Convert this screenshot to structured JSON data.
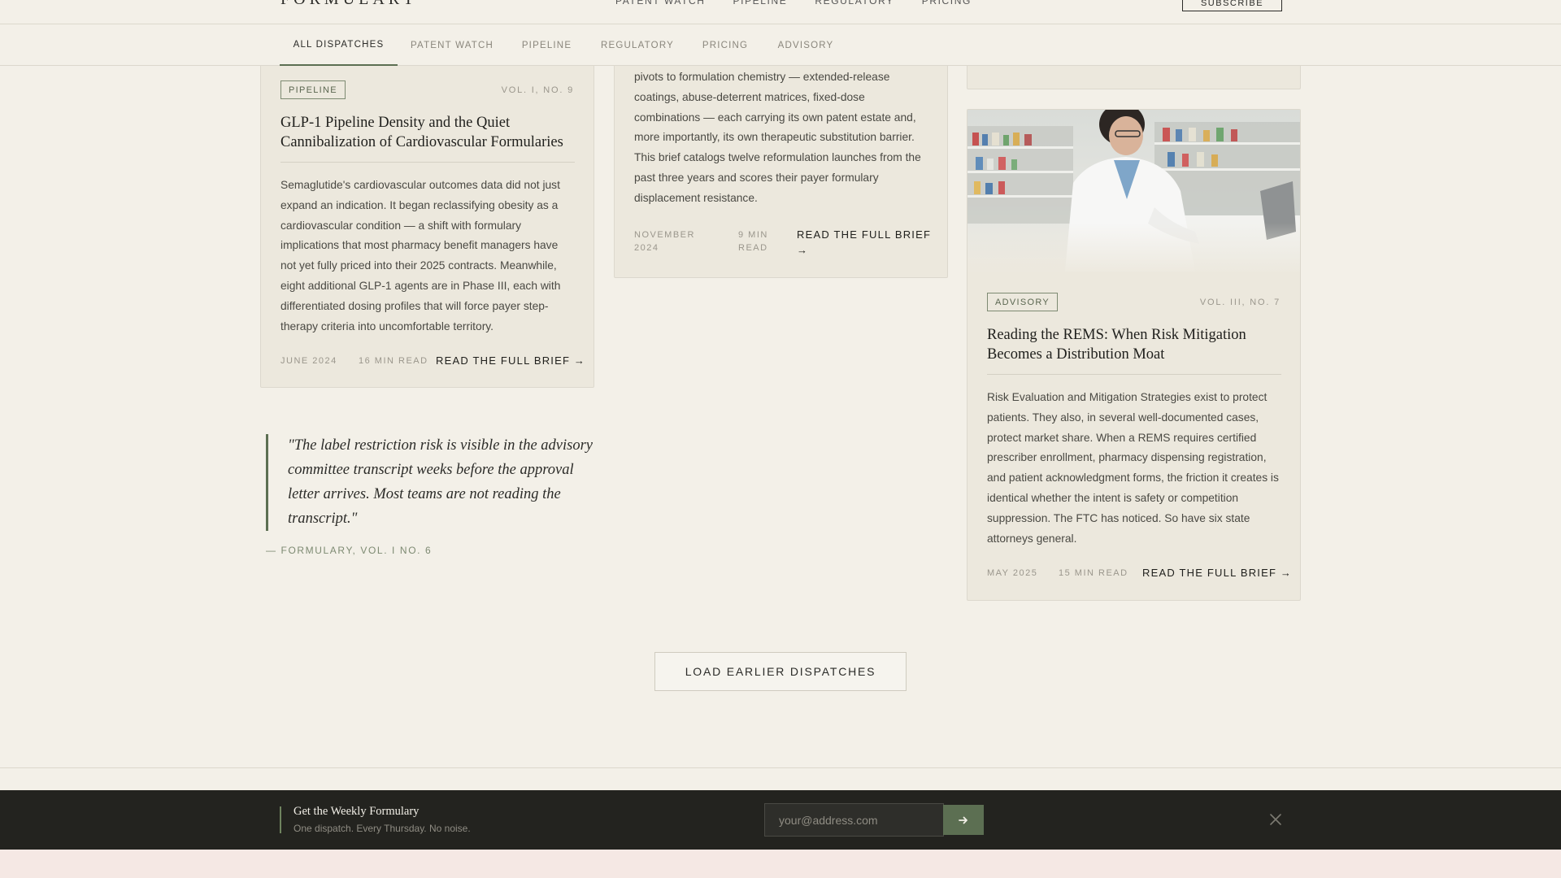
{
  "header": {
    "brand": "FORMULARY",
    "nav": [
      "PATENT WATCH",
      "PIPELINE",
      "REGULATORY",
      "PRICING"
    ],
    "subscribe_label": "SUBSCRIBE"
  },
  "tabs": [
    "ALL DISPATCHES",
    "PATENT WATCH",
    "PIPELINE",
    "REGULATORY",
    "PRICING",
    "ADVISORY"
  ],
  "cards": {
    "pipeline": {
      "tag": "PIPELINE",
      "vol": "VOL. I, NO. 9",
      "title": "GLP-1 Pipeline Density and the Quiet Cannibalization of Cardiovascular Formularies",
      "body": "Semaglutide's cardiovascular outcomes data did not just expand an indication. It began reclassifying obesity as a cardiovascular condition — a shift with formulary implications that most pharmacy benefit managers have not yet fully priced into their 2025 contracts. Meanwhile, eight additional GLP-1 agents are in Phase III, each with differentiated dosing profiles that will force payer step-therapy criteria into uncomfortable territory.",
      "date": "JUNE 2024",
      "read_time": "16 MIN READ",
      "read_label": "READ THE FULL BRIEF →"
    },
    "reformulation": {
      "body": "pivots to formulation chemistry — extended-release coatings, abuse-deterrent matrices, fixed-dose combinations — each carrying its own patent estate and, more importantly, its own therapeutic substitution barrier. This brief catalogs twelve reformulation launches from the past three years and scores their payer formulary displacement resistance.",
      "date": "NOVEMBER 2024",
      "read_time": "9 MIN READ",
      "read_label": "READ THE FULL BRIEF →"
    },
    "advisory": {
      "tag": "ADVISORY",
      "vol": "VOL. III, NO. 7",
      "title": "Reading the REMS: When Risk Mitigation Becomes a Distribution Moat",
      "body": "Risk Evaluation and Mitigation Strategies exist to protect patients. They also, in several well-documented cases, protect market share. When a REMS requires certified prescriber enrollment, pharmacy dispensing registration, and patient acknowledgment forms, the friction it creates is identical whether the intent is safety or competition suppression. The FTC has noticed. So have six state attorneys general.",
      "date": "MAY 2025",
      "read_time": "15 MIN READ",
      "read_label": "READ THE FULL BRIEF →"
    }
  },
  "quote": {
    "text": "\"The label restriction risk is visible in the advisory committee transcript weeks before the approval letter arrives. Most teams are not reading the transcript.\"",
    "cite": "— FORMULARY, VOL. I NO. 6"
  },
  "load_more_label": "LOAD EARLIER DISPATCHES",
  "newsletter": {
    "title": "Get the Weekly Formulary",
    "subtitle": "One dispatch. Every Thursday. No noise.",
    "placeholder": "your@address.com",
    "submit_icon": "arrow-right-icon",
    "close_icon": "close-icon"
  },
  "colors": {
    "background": "#f3f0e8",
    "card": "#ece8dd",
    "accent": "#5c6f52",
    "newsletter_bg": "#23231f"
  }
}
